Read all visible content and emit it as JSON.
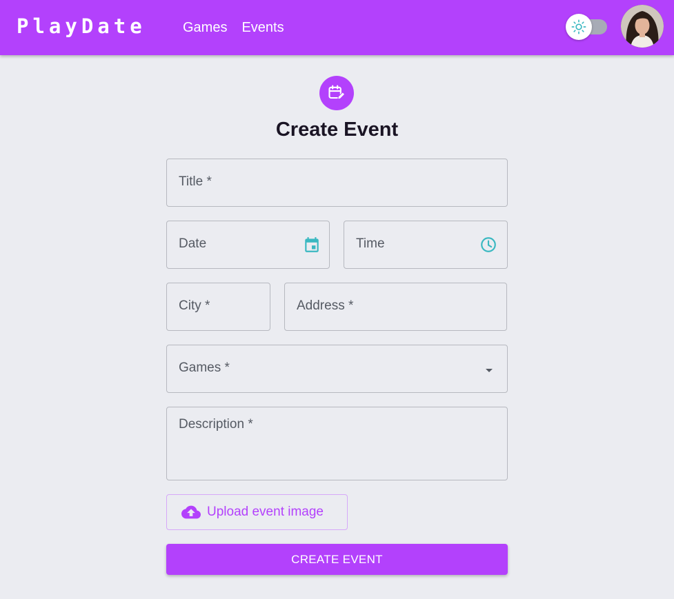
{
  "app": {
    "logo": "PlayDate",
    "nav": [
      "Games",
      "Events"
    ]
  },
  "theme_toggle": {
    "state": "light",
    "icon": "sun-icon"
  },
  "avatar": {
    "icon": "user-avatar"
  },
  "form": {
    "header_icon": "calendar-edit-icon",
    "title": "Create Event",
    "fields": {
      "title": "Title *",
      "date": "Date",
      "time": "Time",
      "city": "City *",
      "address": "Address *",
      "games": "Games *",
      "description": "Description *"
    },
    "upload_label": "Upload event image",
    "submit_label": "CREATE EVENT"
  },
  "colors": {
    "primary": "#b341fc",
    "accent": "#3ab8c1",
    "background": "#ebecf1"
  }
}
